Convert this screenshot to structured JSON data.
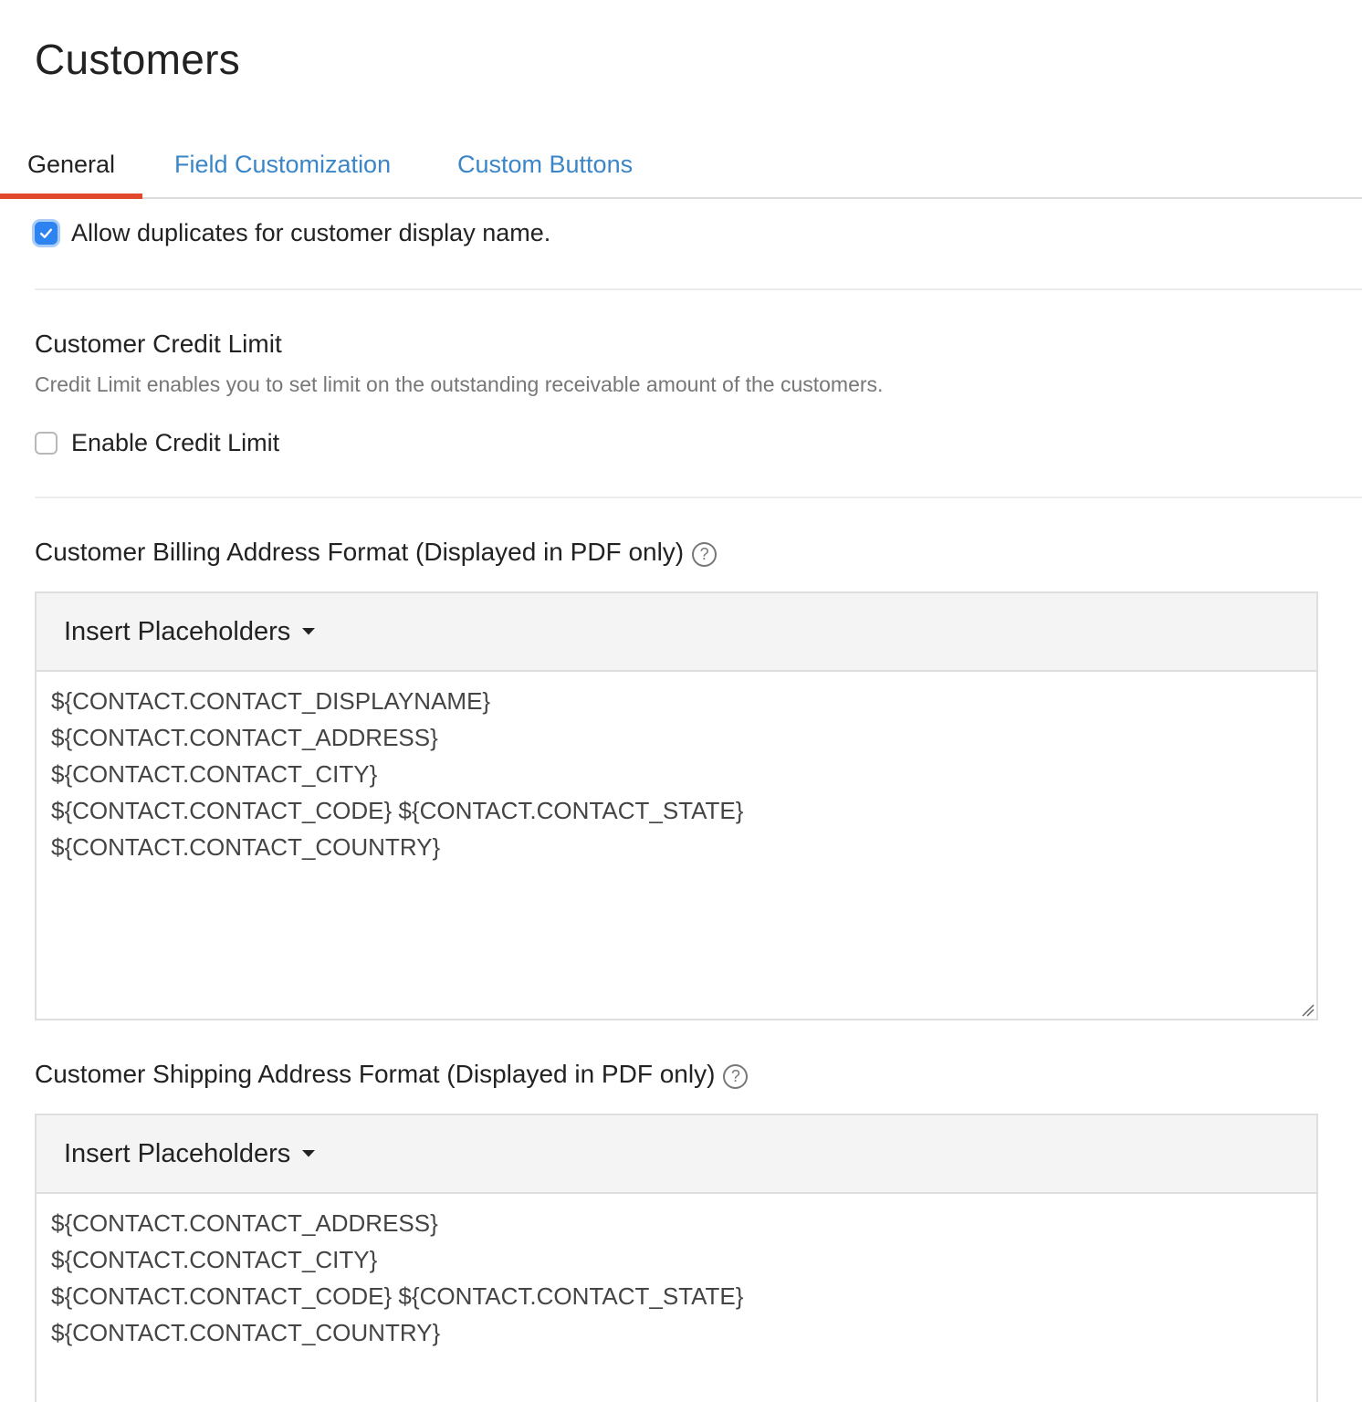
{
  "page": {
    "title": "Customers"
  },
  "tabs": [
    {
      "label": "General",
      "active": true
    },
    {
      "label": "Field Customization",
      "active": false
    },
    {
      "label": "Custom Buttons",
      "active": false
    }
  ],
  "duplicates": {
    "label": "Allow duplicates for customer display name.",
    "checked": true
  },
  "credit_limit": {
    "title": "Customer Credit Limit",
    "description": "Credit Limit enables you to set limit on the outstanding receivable amount of the customers.",
    "checkbox_label": "Enable Credit Limit",
    "checked": false
  },
  "billing": {
    "title": "Customer Billing Address Format (Displayed in PDF only)",
    "help_icon": "?",
    "toolbar_label": "Insert Placeholders",
    "lines": [
      "${CONTACT.CONTACT_DISPLAYNAME}",
      "${CONTACT.CONTACT_ADDRESS}",
      "${CONTACT.CONTACT_CITY}",
      "${CONTACT.CONTACT_CODE} ${CONTACT.CONTACT_STATE}",
      "${CONTACT.CONTACT_COUNTRY}"
    ]
  },
  "shipping": {
    "title": "Customer Shipping Address Format (Displayed in PDF only)",
    "help_icon": "?",
    "toolbar_label": "Insert Placeholders",
    "lines": [
      "${CONTACT.CONTACT_ADDRESS}",
      "${CONTACT.CONTACT_CITY}",
      "${CONTACT.CONTACT_CODE} ${CONTACT.CONTACT_STATE}",
      "${CONTACT.CONTACT_COUNTRY}"
    ]
  },
  "colors": {
    "accent": "#e1482c",
    "link": "#3a86c8",
    "checkbox_checked": "#2d84f0"
  }
}
